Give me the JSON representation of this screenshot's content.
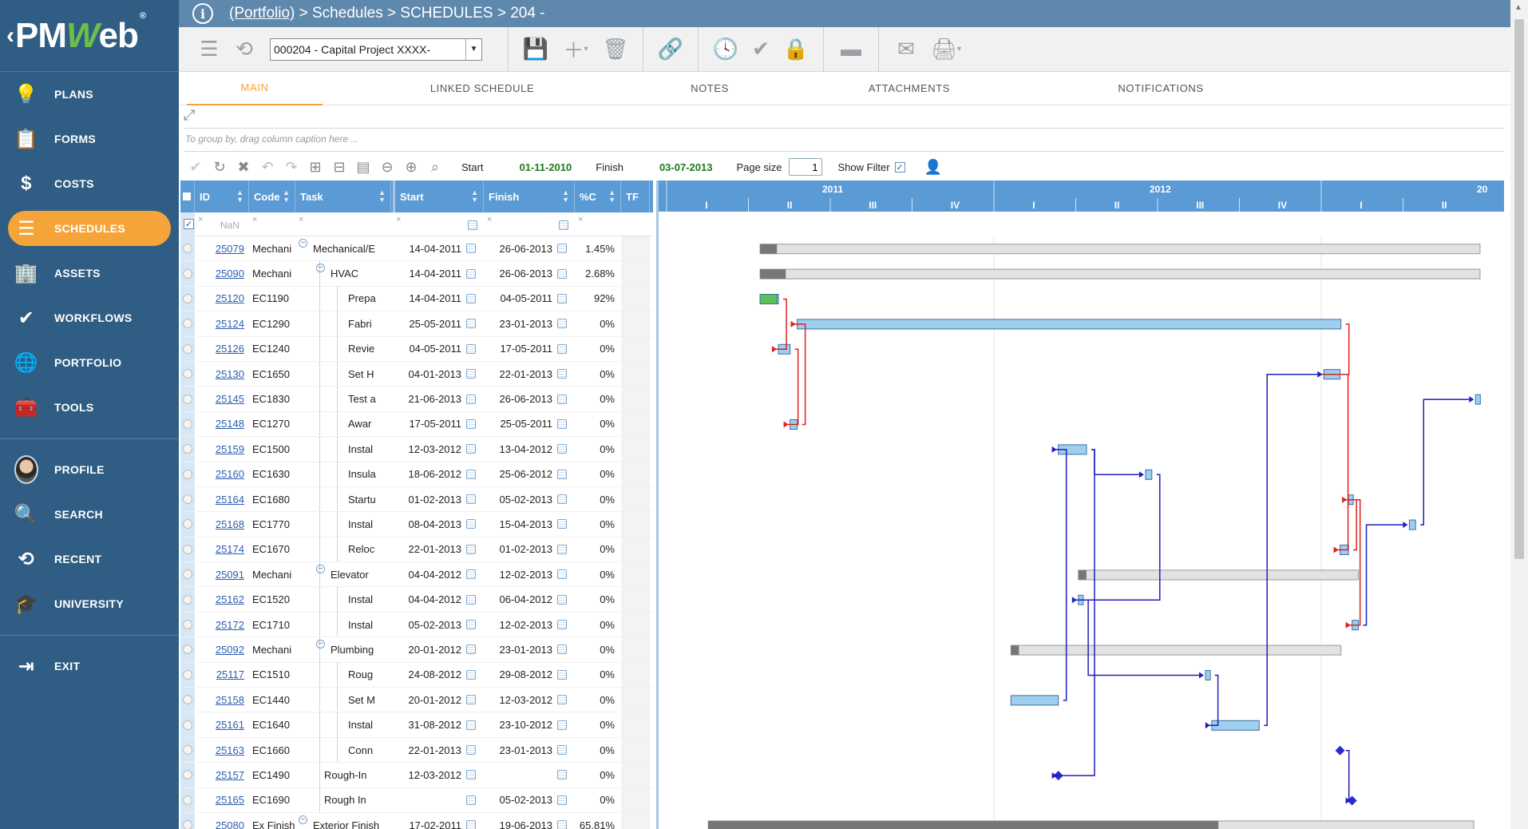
{
  "sidebar": {
    "logo": {
      "prefix": "PM",
      "w": "W",
      "suffix": "eb",
      "reg": "®"
    },
    "items": [
      {
        "label": "PLANS",
        "icon": "lightbulb-icon",
        "glyph": "💡"
      },
      {
        "label": "FORMS",
        "icon": "clipboard-icon",
        "glyph": "📋"
      },
      {
        "label": "COSTS",
        "icon": "dollar-icon",
        "glyph": "$"
      },
      {
        "label": "SCHEDULES",
        "icon": "schedule-bars-icon",
        "glyph": "☰",
        "active": true
      },
      {
        "label": "ASSETS",
        "icon": "building-icon",
        "glyph": "🏢"
      },
      {
        "label": "WORKFLOWS",
        "icon": "checkmark-icon",
        "glyph": "✔"
      },
      {
        "label": "PORTFOLIO",
        "icon": "globe-icon",
        "glyph": "🌐"
      },
      {
        "label": "TOOLS",
        "icon": "toolbox-icon",
        "glyph": "🧰"
      }
    ],
    "items2": [
      {
        "label": "PROFILE",
        "icon": "avatar"
      },
      {
        "label": "SEARCH",
        "icon": "search-icon",
        "glyph": "🔍"
      },
      {
        "label": "RECENT",
        "icon": "history-icon",
        "glyph": "⟲"
      },
      {
        "label": "UNIVERSITY",
        "icon": "graduation-cap-icon",
        "glyph": "🎓"
      }
    ],
    "exit": {
      "label": "EXIT",
      "icon": "exit-icon",
      "glyph": "⇥"
    }
  },
  "breadcrumb": {
    "portfolio": "(Portfolio)",
    "rest": " > Schedules > SCHEDULES > 204 -"
  },
  "toolbar": {
    "project_value": "000204 - Capital Project XXXX-"
  },
  "tabs": [
    "MAIN",
    "LINKED SCHEDULE",
    "NOTES",
    "ATTACHMENTS",
    "NOTIFICATIONS"
  ],
  "grid_toolbar": {
    "group_hint": "To group by, drag column caption here ...",
    "start_label": "Start",
    "start_value": "01-11-2010",
    "finish_label": "Finish",
    "finish_value": "03-07-2013",
    "page_size_label": "Page size",
    "page_size_value": "1",
    "show_filter_label": "Show Filter"
  },
  "grid": {
    "columns": [
      "ID",
      "Code",
      "Task",
      "Start",
      "Finish",
      "%C",
      "TF"
    ],
    "filter_nan": "NaN",
    "rows": [
      {
        "id": "25079",
        "code": "Mechani",
        "task": "Mechanical/E",
        "start": "14-04-2011",
        "finish": "26-06-2013",
        "pc": "1.45%",
        "level": 0,
        "toggle": true
      },
      {
        "id": "25090",
        "code": "Mechani",
        "task": "HVAC",
        "start": "14-04-2011",
        "finish": "26-06-2013",
        "pc": "2.68%",
        "level": 1,
        "toggle": true
      },
      {
        "id": "25120",
        "code": "EC1190",
        "task": "Prepa",
        "start": "14-04-2011",
        "finish": "04-05-2011",
        "pc": "92%",
        "level": 2
      },
      {
        "id": "25124",
        "code": "EC1290",
        "task": "Fabri",
        "start": "25-05-2011",
        "finish": "23-01-2013",
        "pc": "0%",
        "level": 2
      },
      {
        "id": "25126",
        "code": "EC1240",
        "task": "Revie",
        "start": "04-05-2011",
        "finish": "17-05-2011",
        "pc": "0%",
        "level": 2
      },
      {
        "id": "25130",
        "code": "EC1650",
        "task": "Set H",
        "start": "04-01-2013",
        "finish": "22-01-2013",
        "pc": "0%",
        "level": 2
      },
      {
        "id": "25145",
        "code": "EC1830",
        "task": "Test a",
        "start": "21-06-2013",
        "finish": "26-06-2013",
        "pc": "0%",
        "level": 2
      },
      {
        "id": "25148",
        "code": "EC1270",
        "task": "Awar",
        "start": "17-05-2011",
        "finish": "25-05-2011",
        "pc": "0%",
        "level": 2
      },
      {
        "id": "25159",
        "code": "EC1500",
        "task": "Instal",
        "start": "12-03-2012",
        "finish": "13-04-2012",
        "pc": "0%",
        "level": 2
      },
      {
        "id": "25160",
        "code": "EC1630",
        "task": "Insula",
        "start": "18-06-2012",
        "finish": "25-06-2012",
        "pc": "0%",
        "level": 2
      },
      {
        "id": "25164",
        "code": "EC1680",
        "task": "Startu",
        "start": "01-02-2013",
        "finish": "05-02-2013",
        "pc": "0%",
        "level": 2
      },
      {
        "id": "25168",
        "code": "EC1770",
        "task": "Instal",
        "start": "08-04-2013",
        "finish": "15-04-2013",
        "pc": "0%",
        "level": 2
      },
      {
        "id": "25174",
        "code": "EC1670",
        "task": "Reloc",
        "start": "22-01-2013",
        "finish": "01-02-2013",
        "pc": "0%",
        "level": 2
      },
      {
        "id": "25091",
        "code": "Mechani",
        "task": "Elevator",
        "start": "04-04-2012",
        "finish": "12-02-2013",
        "pc": "0%",
        "level": 1,
        "toggle": true
      },
      {
        "id": "25162",
        "code": "EC1520",
        "task": "Instal",
        "start": "04-04-2012",
        "finish": "06-04-2012",
        "pc": "0%",
        "level": 2
      },
      {
        "id": "25172",
        "code": "EC1710",
        "task": "Instal",
        "start": "05-02-2013",
        "finish": "12-02-2013",
        "pc": "0%",
        "level": 2
      },
      {
        "id": "25092",
        "code": "Mechani",
        "task": "Plumbing",
        "start": "20-01-2012",
        "finish": "23-01-2013",
        "pc": "0%",
        "level": 1,
        "toggle": true
      },
      {
        "id": "25117",
        "code": "EC1510",
        "task": "Roug",
        "start": "24-08-2012",
        "finish": "29-08-2012",
        "pc": "0%",
        "level": 2
      },
      {
        "id": "25158",
        "code": "EC1440",
        "task": "Set M",
        "start": "20-01-2012",
        "finish": "12-03-2012",
        "pc": "0%",
        "level": 2
      },
      {
        "id": "25161",
        "code": "EC1640",
        "task": "Instal",
        "start": "31-08-2012",
        "finish": "23-10-2012",
        "pc": "0%",
        "level": 2
      },
      {
        "id": "25163",
        "code": "EC1660",
        "task": "Conn",
        "start": "22-01-2013",
        "finish": "23-01-2013",
        "pc": "0%",
        "level": 2
      },
      {
        "id": "25157",
        "code": "EC1490",
        "task": "Rough-In",
        "start": "12-03-2012",
        "finish": "",
        "pc": "0%",
        "level": 1
      },
      {
        "id": "25165",
        "code": "EC1690",
        "task": "Rough In",
        "start": "",
        "finish": "05-02-2013",
        "pc": "0%",
        "level": 1
      },
      {
        "id": "25080",
        "code": "Ex Finish",
        "task": "Exterior Finish",
        "start": "17-02-2011",
        "finish": "19-06-2013",
        "pc": "65.81%",
        "level": 0,
        "toggle": true
      }
    ]
  },
  "gantt": {
    "years": [
      {
        "label": "2011",
        "quarters": [
          "I",
          "II",
          "III",
          "IV"
        ]
      },
      {
        "label": "2012",
        "quarters": [
          "I",
          "II",
          "III",
          "IV"
        ]
      },
      {
        "label": "20",
        "quarters": [
          "I",
          "II"
        ]
      }
    ],
    "colors": {
      "summary": "#e2e2e2",
      "task": "#9fcfee",
      "done": "#5cc05c",
      "link_blue": "#1f1fbf",
      "link_red": "#e02020"
    }
  }
}
